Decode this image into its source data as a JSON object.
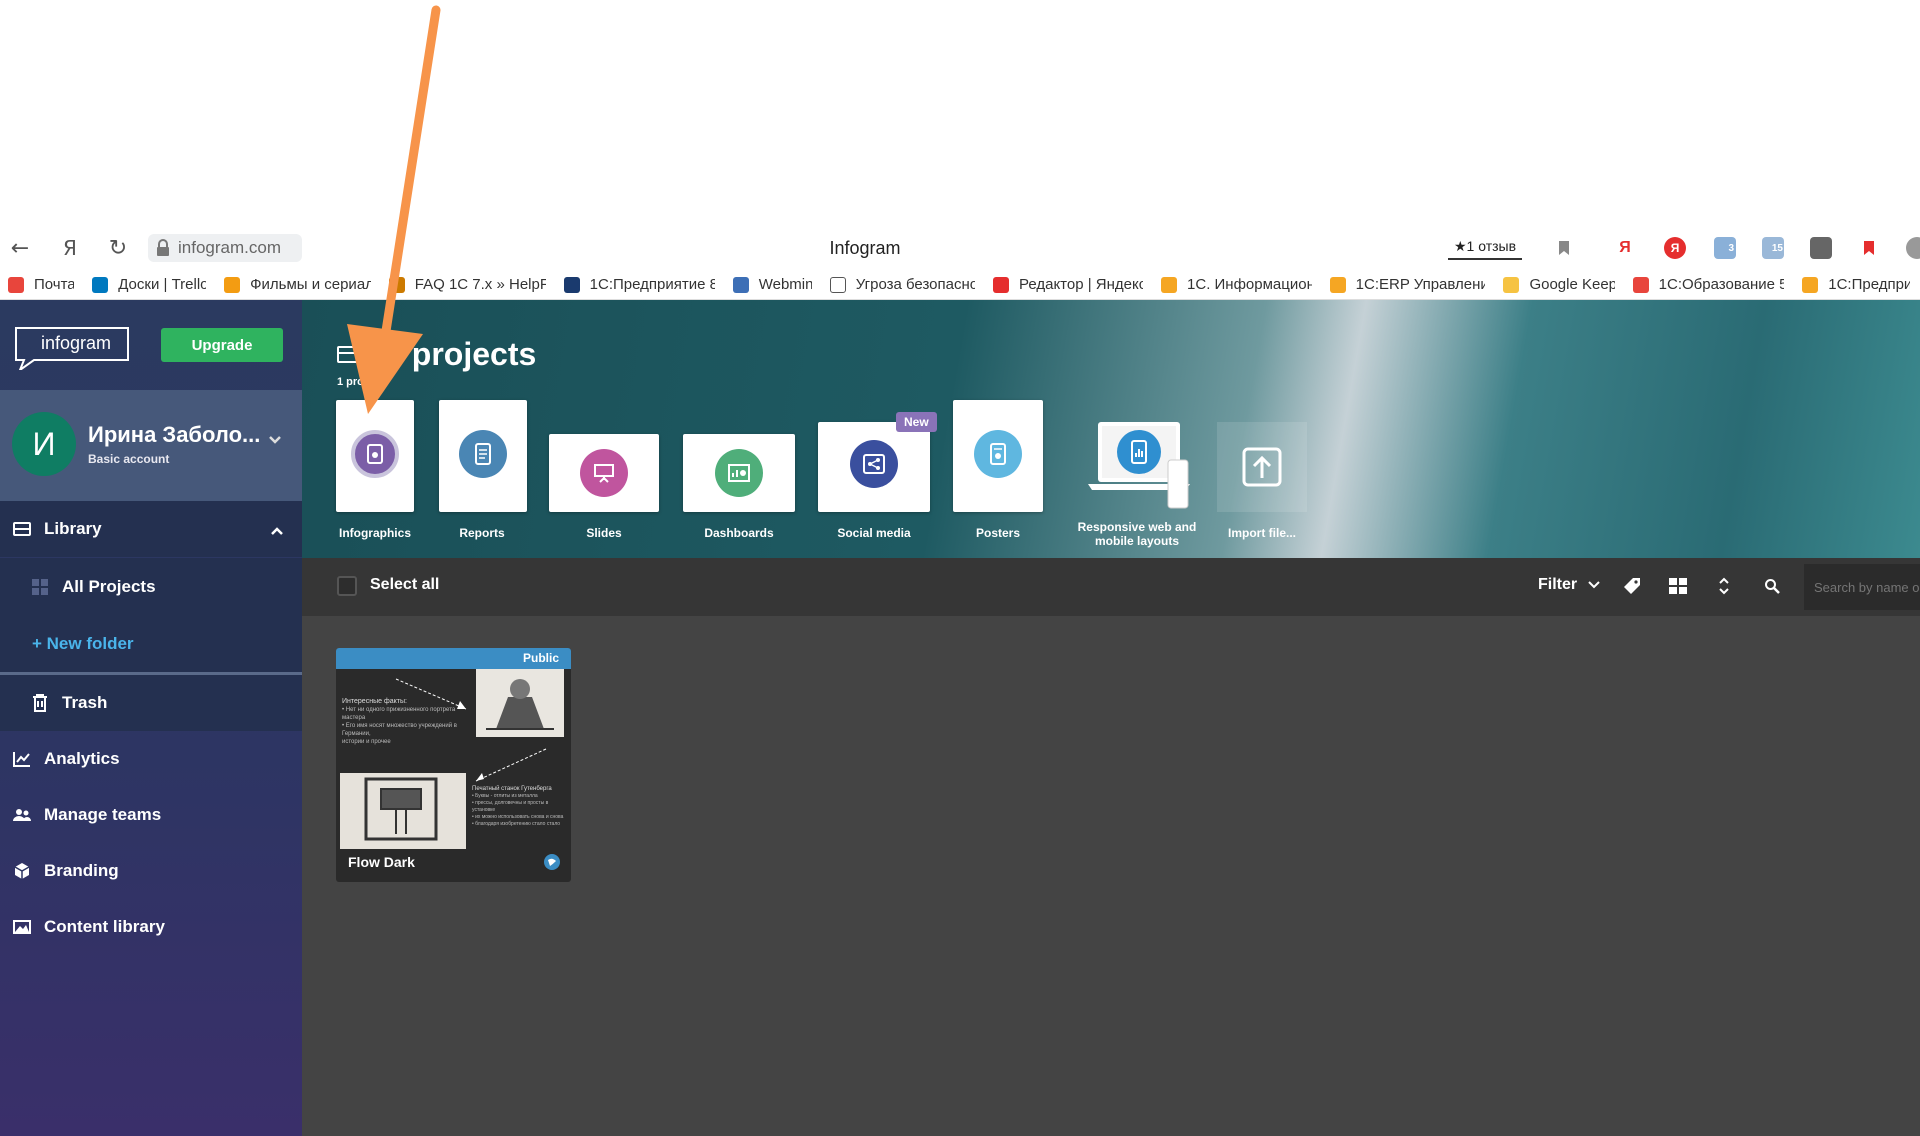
{
  "browser": {
    "url": "infogram.com",
    "title": "Infogram",
    "reviews": "★1 отзыв",
    "nav": {
      "back": "←",
      "yandex": "Я",
      "reload": "↻"
    },
    "ext_yandex_label": "Я",
    "ext_mail_count": "3",
    "ext_weather_temp": "15"
  },
  "bookmarks": [
    {
      "label": "Почта",
      "color": "#e8453c"
    },
    {
      "label": "Доски | Trello",
      "color": "#0079bf"
    },
    {
      "label": "Фильмы и сериал",
      "color": "#f39c12"
    },
    {
      "label": "FAQ 1С 7.x » HelpF",
      "color": "#cc7a00"
    },
    {
      "label": "1С:Предприятие 8",
      "color": "#1a3a6e"
    },
    {
      "label": "Webmin",
      "color": "#3d6fb6"
    },
    {
      "label": "Угроза безопасно",
      "color": "#ffffff"
    },
    {
      "label": "Редактор | Яндекс",
      "color": "#e52e2e"
    },
    {
      "label": "1С. Информацион",
      "color": "#f5a623"
    },
    {
      "label": "1С:ERP Управлени",
      "color": "#f5a623"
    },
    {
      "label": "Google Keep",
      "color": "#f6c342"
    },
    {
      "label": "1С:Образование 5",
      "color": "#e8453c"
    },
    {
      "label": "1С:Предпри",
      "color": "#f5a623"
    }
  ],
  "sidebar": {
    "logo": "infogram",
    "upgrade": "Upgrade",
    "user": {
      "initial": "И",
      "name": "Ирина Заболо...",
      "plan": "Basic account"
    },
    "library": "Library",
    "all_projects": "All Projects",
    "new_folder": "+ New folder",
    "trash": "Trash",
    "analytics": "Analytics",
    "manage_teams": "Manage teams",
    "branding": "Branding",
    "content_library": "Content library"
  },
  "banner": {
    "title": "All projects",
    "count": "1 project",
    "templates": [
      {
        "label": "Infographics",
        "color": "#7b5ea7"
      },
      {
        "label": "Reports",
        "color": "#4a86b4"
      },
      {
        "label": "Slides",
        "color": "#c0559e"
      },
      {
        "label": "Dashboards",
        "color": "#4fae7a"
      },
      {
        "label": "Social media",
        "color": "#3a4f9e",
        "badge": "New"
      },
      {
        "label": "Posters",
        "color": "#5fb7e0"
      },
      {
        "label": "Responsive web and mobile layouts",
        "color": "#2f8fd0"
      },
      {
        "label": "Import file...",
        "color": "#ffffff"
      }
    ]
  },
  "toolbar": {
    "select_all": "Select all",
    "filter": "Filter",
    "search_placeholder": "Search by name or"
  },
  "project": {
    "name": "Flow Dark",
    "visibility": "Public",
    "text1_title": "Интересные факты:",
    "text1_lines": [
      "• Нет ни одного прижизненного портрета мастера",
      "• Его имя носят множество учреждений в Германии,",
      "истории и прочее"
    ],
    "text2_title": "Печатный станок Гутенберга",
    "text2_lines": [
      "• Буквы - отлиты из металла",
      "• прессы, долговечны и просты в",
      "установке",
      "• их можно использовать снова и снова",
      "• благодаря изобретению стало стало"
    ]
  }
}
